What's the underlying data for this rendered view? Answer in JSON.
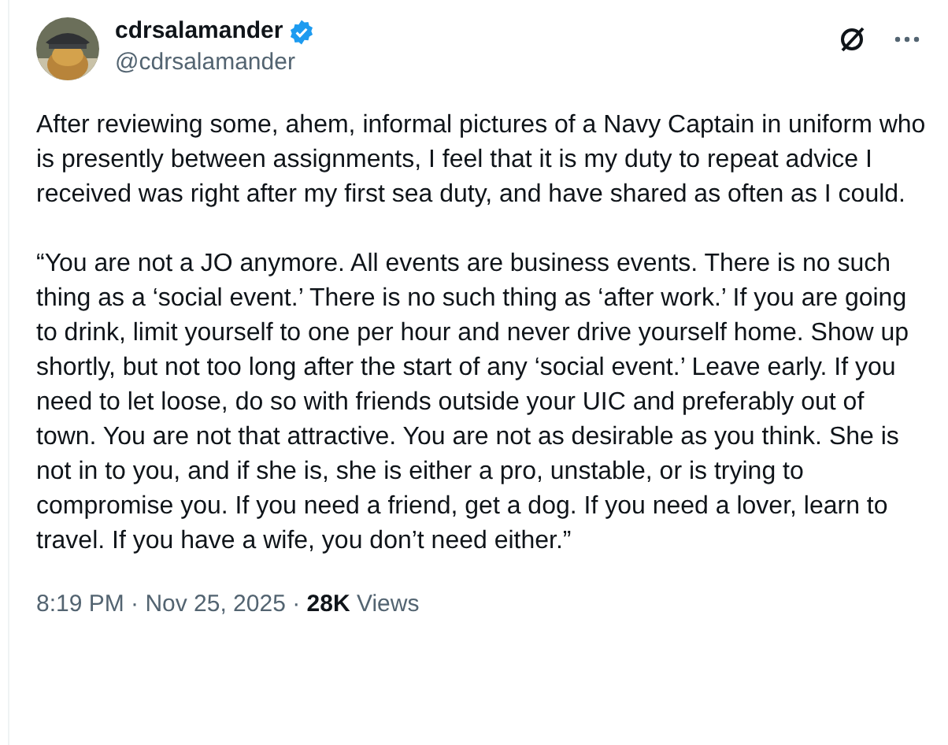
{
  "author": {
    "name": "cdrsalamander",
    "verified": true,
    "handle": "@cdrsalamander"
  },
  "paragraphs": [
    "After reviewing some, ahem, informal pictures of a Navy Captain in uniform who is presently between assignments, I feel that it is my duty to repeat advice I received was right after my first sea duty, and have shared as often as I could.",
    "“You are not a JO anymore. All events are business events. There is no such thing as a ‘social event.’ There is no such thing as ‘after work.’ If you are going to drink, limit yourself to one per hour and never drive yourself home. Show up shortly, but not too long after the start of any ‘social event.’ Leave early. If you need to let loose, do so with friends outside your UIC and preferably out of town. You are not that attractive. You are not as desirable as you think. She is not in to you, and if she is, she is either a pro, unstable, or is trying to compromise you. If you need a friend, get a dog. If you need a lover, learn to travel. If you have a wife, you don’t need either.”"
  ],
  "meta": "8:19 PM · Nov 25, 2025 · **28K** Views"
}
